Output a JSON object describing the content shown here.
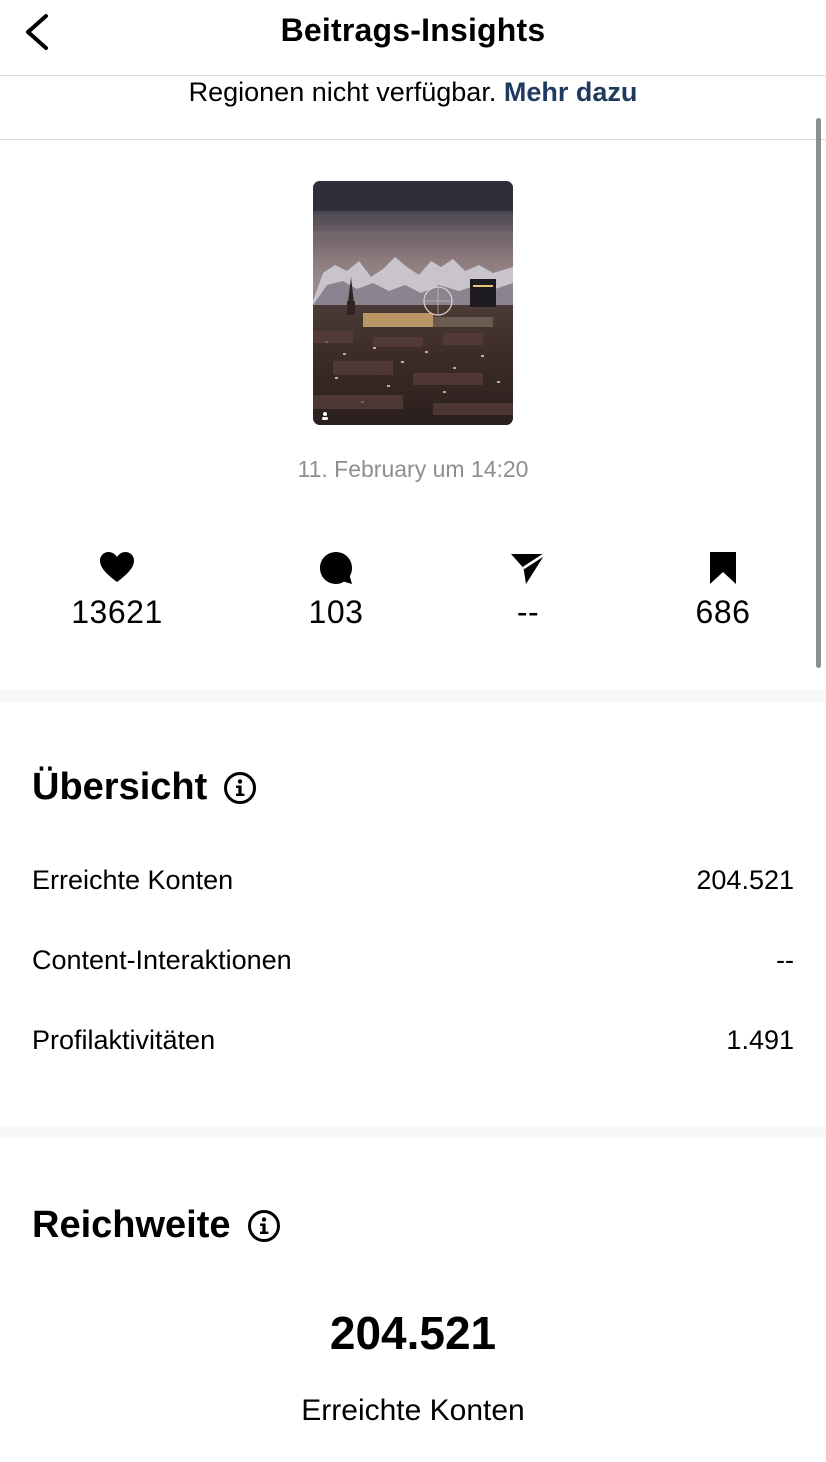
{
  "header": {
    "title": "Beitrags-Insights"
  },
  "notice": {
    "text": "Regionen nicht verfügbar.",
    "link": "Mehr dazu"
  },
  "post": {
    "date": "11. February um 14:20"
  },
  "stats": {
    "likes": "13621",
    "comments": "103",
    "shares": "--",
    "saves": "686"
  },
  "overview": {
    "title": "Übersicht",
    "rows": [
      {
        "label": "Erreichte Konten",
        "value": "204.521"
      },
      {
        "label": "Content-Interaktionen",
        "value": "--"
      },
      {
        "label": "Profilaktivitäten",
        "value": "1.491"
      }
    ]
  },
  "reach": {
    "title": "Reichweite",
    "value": "204.521",
    "label": "Erreichte Konten"
  },
  "icons": {
    "back": "chevron-left-icon",
    "like": "heart-icon",
    "comment": "comment-bubble-icon",
    "share": "paper-plane-icon",
    "save": "bookmark-icon",
    "info": "info-icon"
  },
  "colors": {
    "link": "#1e3a5f",
    "muted": "#8e8e8e",
    "divider": "#dbdbdb"
  }
}
